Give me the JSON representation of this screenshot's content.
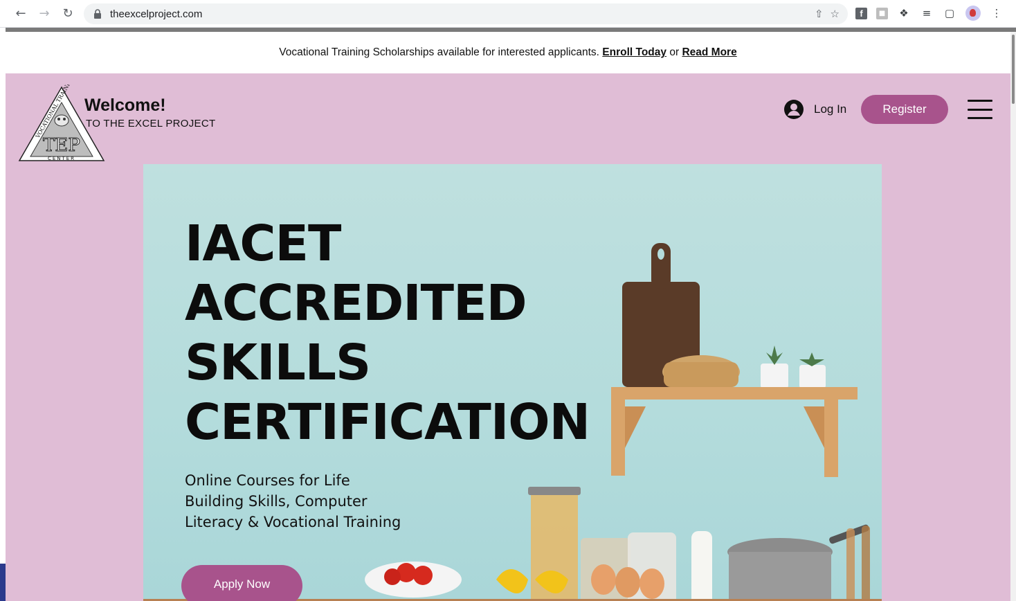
{
  "browser": {
    "url": "theexcelproject.com",
    "icons": [
      "back-icon",
      "forward-icon",
      "reload-icon",
      "lock-icon",
      "share-icon",
      "star-icon",
      "facebook-extension-icon",
      "extension-icon",
      "puzzle-icon",
      "media-icon",
      "sidepanel-icon",
      "profile-avatar",
      "menu-kebab-icon"
    ]
  },
  "announcement": {
    "text": "Vocational Training Scholarships available for interested applicants.",
    "enroll_link": "Enroll Today",
    "or": "or",
    "read_more_link": "Read More"
  },
  "header": {
    "logo_text_top": "VOCATIONAL TRAINING",
    "logo_monogram": "TEP",
    "logo_text_bottom": "CENTER",
    "welcome": "Welcome!",
    "subtitle": "TO THE EXCEL PROJECT",
    "login_label": "Log In",
    "register_label": "Register"
  },
  "hero": {
    "title_lines": [
      "IACET",
      "ACCREDITED",
      "SKILLS",
      "CERTIFICATION"
    ],
    "subtitle_lines": [
      "Online Courses for Life",
      "Building Skills, Computer",
      "Literacy & Vocational Training"
    ],
    "cta_label": "Apply Now"
  },
  "colors": {
    "page_background": "#e0bdd6",
    "accent": "#a8538c",
    "hero_background": "#b4dcdc",
    "announcement_background": "#ffffff"
  }
}
